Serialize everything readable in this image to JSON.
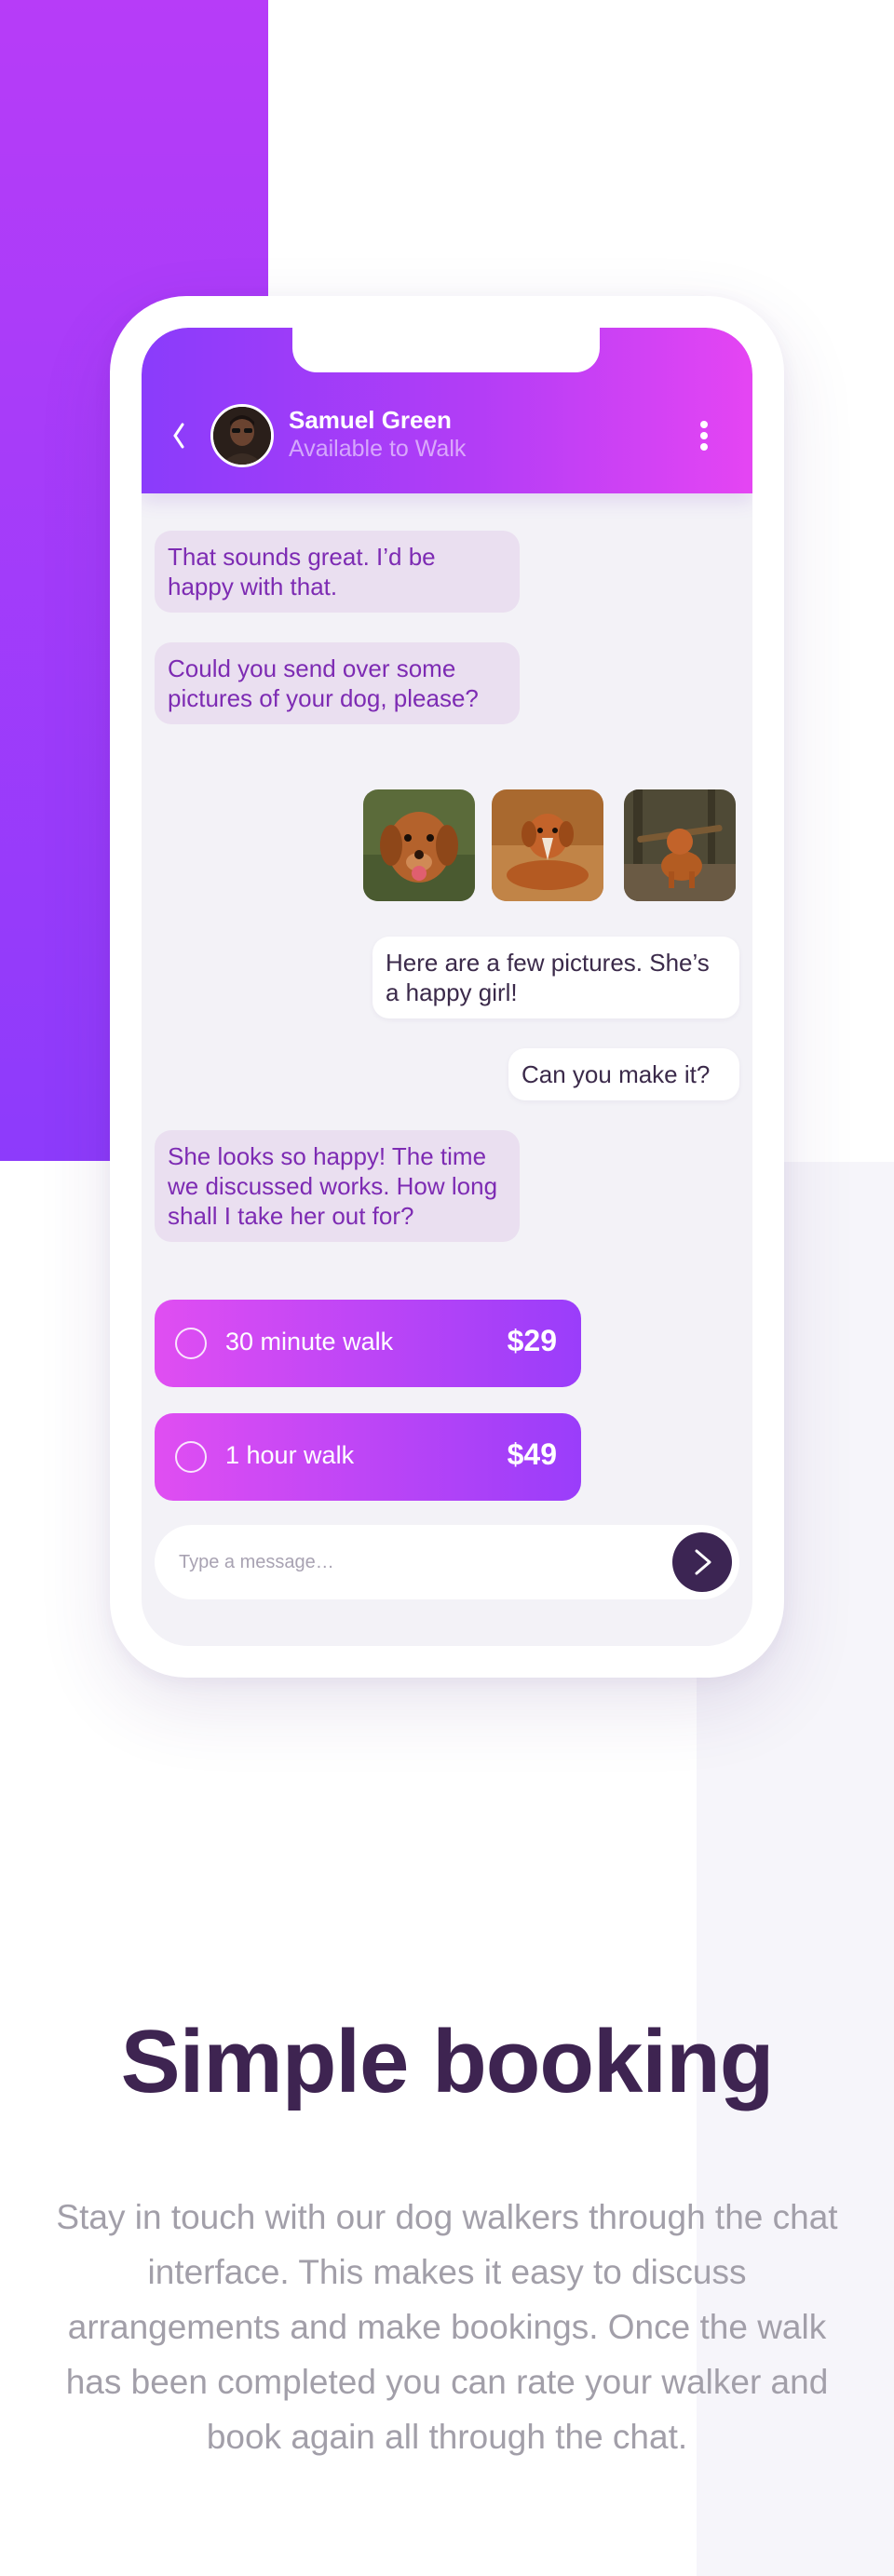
{
  "chat": {
    "contact_name": "Samuel Green",
    "contact_status": "Available to Walk",
    "messages": {
      "m1": "That sounds great. I’d be happy with that.",
      "m2": "Could you send over some pictures of your dog, please?",
      "m3": "Here are a few pictures. She’s a happy girl!",
      "m4": "Can you make it?",
      "m5": "She looks so happy! The time we discussed works. How long shall I take her out for?"
    },
    "options": [
      {
        "label": "30 minute walk",
        "price": "$29"
      },
      {
        "label": "1 hour walk",
        "price": "$49"
      }
    ],
    "input_placeholder": "Type a message…"
  },
  "section": {
    "title": "Simple booking",
    "description": "Stay in touch with our dog walkers through the chat interface. This makes it easy to discuss arrangements and make bookings. Once the walk has been completed you can rate your walker and book again all through the chat."
  },
  "colors": {
    "brand_purple": "#8a3cfb",
    "brand_magenta": "#e545f3",
    "dark_title": "#3e2451",
    "incoming_bubble": "#eadff0"
  }
}
